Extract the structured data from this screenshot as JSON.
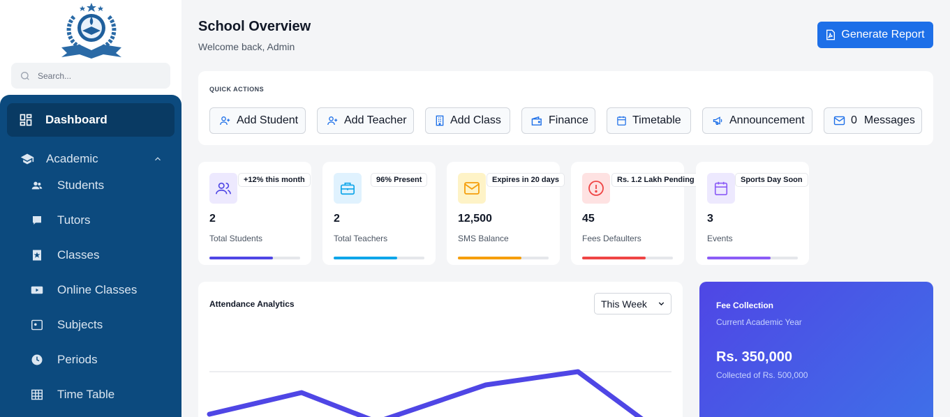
{
  "sidebar": {
    "search_placeholder": "Search...",
    "active_item": "Dashboard",
    "section": "Academic",
    "items": [
      "Students",
      "Tutors",
      "Classes",
      "Online Classes",
      "Subjects",
      "Periods",
      "Time Table"
    ]
  },
  "header": {
    "title": "School Overview",
    "subtitle": "Welcome back, Admin",
    "report_button": "Generate Report"
  },
  "quick_actions": {
    "title": "QUICK ACTIONS",
    "buttons": [
      "Add Student",
      "Add Teacher",
      "Add Class",
      "Finance",
      "Timetable",
      "Announcement"
    ],
    "messages_count": "0",
    "messages_label": "Messages"
  },
  "stats": [
    {
      "badge": "+12% this month",
      "value": "2",
      "label": "Total Students",
      "progress": 0.7,
      "color": "#4f46e5",
      "bg": "#ede9fe",
      "icon": "users-icon"
    },
    {
      "badge": "96% Present",
      "value": "2",
      "label": "Total Teachers",
      "progress": 0.7,
      "color": "#0ea5e9",
      "bg": "#e0f2fe",
      "icon": "briefcase-icon"
    },
    {
      "badge": "Expires in 20 days",
      "value": "12,500",
      "label": "SMS Balance",
      "progress": 0.7,
      "color": "#f59e0b",
      "bg": "#fef3c7",
      "icon": "mail-icon"
    },
    {
      "badge": "Rs. 1.2 Lakh Pending",
      "value": "45",
      "label": "Fees Defaulters",
      "progress": 0.7,
      "color": "#ef4444",
      "bg": "#fee2e2",
      "icon": "alert-circle-icon"
    },
    {
      "badge": "Sports Day Soon",
      "value": "3",
      "label": "Events",
      "progress": 0.7,
      "color": "#8b5cf6",
      "bg": "#ede9fe",
      "icon": "calendar-icon"
    }
  ],
  "attendance": {
    "title": "Attendance Analytics",
    "period": "This Week",
    "line_color": "#4f46e5"
  },
  "fee": {
    "title": "Fee Collection",
    "subtitle": "Current Academic Year",
    "amount": "Rs. 350,000",
    "collected_of": "Collected of Rs. 500,000"
  }
}
